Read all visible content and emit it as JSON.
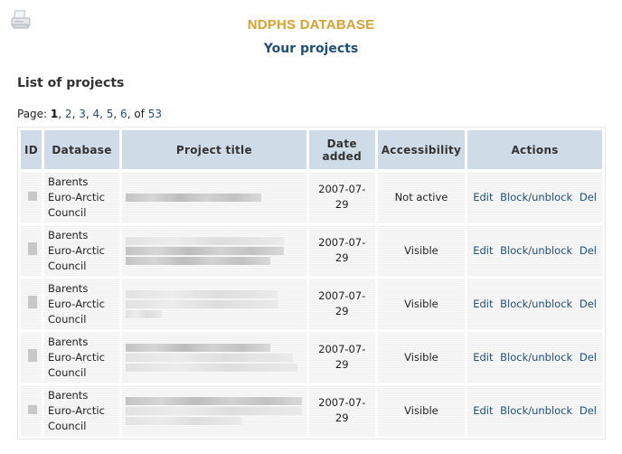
{
  "header": {
    "print_icon": "printer-icon",
    "site_title": "NDPHS DATABASE",
    "page_title": "Your projects"
  },
  "section_title": "List of projects",
  "pager": {
    "label": "Page:",
    "current": "1",
    "pages": [
      "2",
      "3",
      "4",
      "5",
      "6"
    ],
    "of_label": "of",
    "total": "53"
  },
  "table": {
    "columns": [
      "ID",
      "Database",
      "Project title",
      "Date added",
      "Accessibility",
      "Actions"
    ],
    "rows": [
      {
        "database_lines": [
          "Barents",
          "Euro-Arctic",
          "Council"
        ],
        "date": "2007-07-29",
        "accessibility": "Not active",
        "actions": [
          "Edit",
          "Block/unblock",
          "Del"
        ]
      },
      {
        "database_lines": [
          "Barents",
          "Euro-Arctic",
          "Council"
        ],
        "date": "2007-07-29",
        "accessibility": "Visible",
        "actions": [
          "Edit",
          "Block/unblock",
          "Del"
        ]
      },
      {
        "database_lines": [
          "Barents",
          "Euro-Arctic",
          "Council"
        ],
        "date": "2007-07-29",
        "accessibility": "Visible",
        "actions": [
          "Edit",
          "Block/unblock",
          "Del"
        ]
      },
      {
        "database_lines": [
          "Barents",
          "Euro-Arctic",
          "Council"
        ],
        "date": "2007-07-29",
        "accessibility": "Visible",
        "actions": [
          "Edit",
          "Block/unblock",
          "Del"
        ]
      },
      {
        "database_lines": [
          "Barents",
          "Euro-Arctic",
          "Council"
        ],
        "date": "2007-07-29",
        "accessibility": "Visible",
        "actions": [
          "Edit",
          "Block/unblock",
          "Del"
        ]
      }
    ]
  },
  "colors": {
    "site_title": "#d9a12e",
    "page_title": "#1f4f7a",
    "header_cell": "#cfdbe6",
    "link": "#1f4f7a"
  }
}
